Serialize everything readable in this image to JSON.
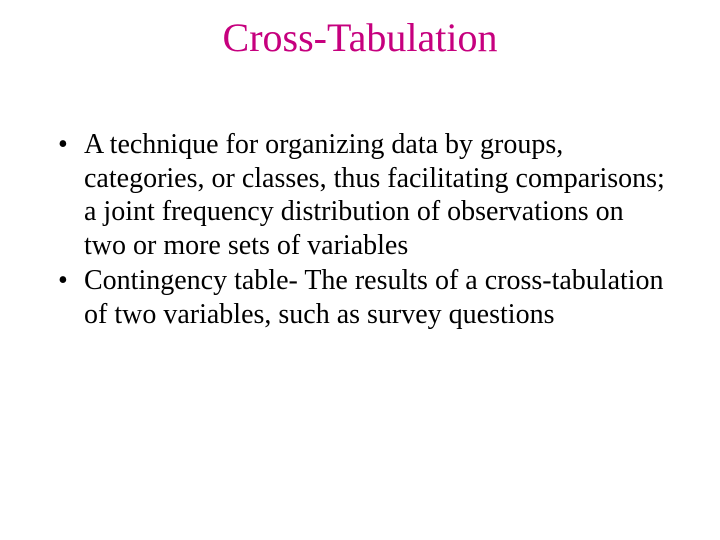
{
  "title": {
    "text": "Cross-Tabulation",
    "color": "#c6007e"
  },
  "bullets": [
    "A technique for organizing data by groups, categories, or classes, thus facilitating comparisons; a joint frequency distribution of observations on two or more sets of variables",
    "Contingency table- The results of a cross-tabulation of two variables, such as survey questions"
  ]
}
